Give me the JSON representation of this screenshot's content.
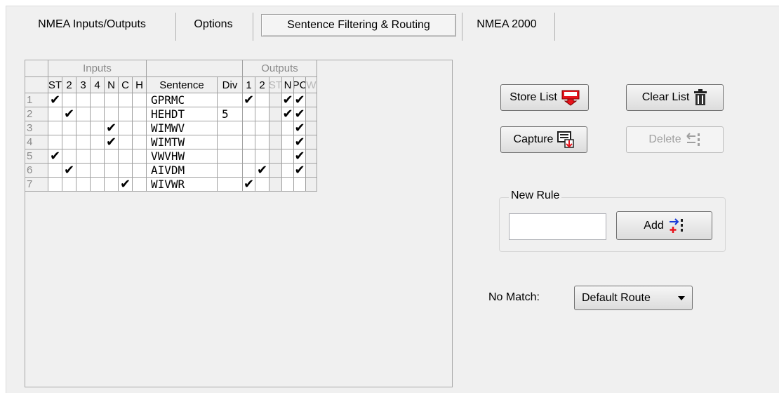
{
  "tabs": [
    {
      "label": "NMEA Inputs/Outputs",
      "active": false
    },
    {
      "label": "Options",
      "active": false
    },
    {
      "label": "Sentence Filtering & Routing",
      "active": true
    },
    {
      "label": "NMEA 2000",
      "active": false
    }
  ],
  "grid": {
    "input_group_label": "Inputs",
    "output_group_label": "Outputs",
    "input_cols": [
      "ST",
      "2",
      "3",
      "4",
      "N",
      "C",
      "H"
    ],
    "sentence_col": "Sentence",
    "div_col": "Div",
    "output_cols": [
      "1",
      "2",
      "ST",
      "N",
      "PC",
      "W"
    ],
    "rows": [
      {
        "num": "1",
        "inputs": [
          true,
          false,
          false,
          false,
          false,
          false,
          false
        ],
        "sentence": "GPRMC",
        "div": "",
        "outputs": [
          true,
          false,
          false,
          true,
          true,
          false
        ]
      },
      {
        "num": "2",
        "inputs": [
          false,
          true,
          false,
          false,
          false,
          false,
          false
        ],
        "sentence": "HEHDT",
        "div": "5",
        "outputs": [
          false,
          false,
          false,
          true,
          true,
          false
        ]
      },
      {
        "num": "3",
        "inputs": [
          false,
          false,
          false,
          false,
          true,
          false,
          false
        ],
        "sentence": "WIMWV",
        "div": "",
        "outputs": [
          false,
          false,
          false,
          false,
          true,
          false
        ]
      },
      {
        "num": "4",
        "inputs": [
          false,
          false,
          false,
          false,
          true,
          false,
          false
        ],
        "sentence": "WIMTW",
        "div": "",
        "outputs": [
          false,
          false,
          false,
          false,
          true,
          false
        ]
      },
      {
        "num": "5",
        "inputs": [
          true,
          false,
          false,
          false,
          false,
          false,
          false
        ],
        "sentence": "VWVHW",
        "div": "",
        "outputs": [
          false,
          false,
          false,
          false,
          true,
          false
        ]
      },
      {
        "num": "6",
        "inputs": [
          false,
          true,
          false,
          false,
          false,
          false,
          false
        ],
        "sentence": "AIVDM",
        "div": "",
        "outputs": [
          false,
          true,
          false,
          false,
          true,
          false
        ]
      },
      {
        "num": "7",
        "inputs": [
          false,
          false,
          false,
          false,
          false,
          true,
          false
        ],
        "sentence": "WIVWR",
        "div": "",
        "outputs": [
          true,
          false,
          false,
          false,
          false,
          false
        ]
      }
    ]
  },
  "buttons": {
    "store_list": "Store List",
    "clear_list": "Clear List",
    "capture": "Capture",
    "delete": "Delete",
    "add": "Add"
  },
  "new_rule": {
    "label": "New Rule",
    "value": ""
  },
  "no_match": {
    "label": "No Match:",
    "selected": "Default Route"
  },
  "icons": [
    "store-list-icon",
    "trash-icon",
    "capture-icon",
    "delete-rule-icon",
    "add-rule-icon"
  ],
  "colors": {
    "panel": "#f0f0f0",
    "icon_red": "#e8141c",
    "icon_blue": "#1a3cd8"
  }
}
